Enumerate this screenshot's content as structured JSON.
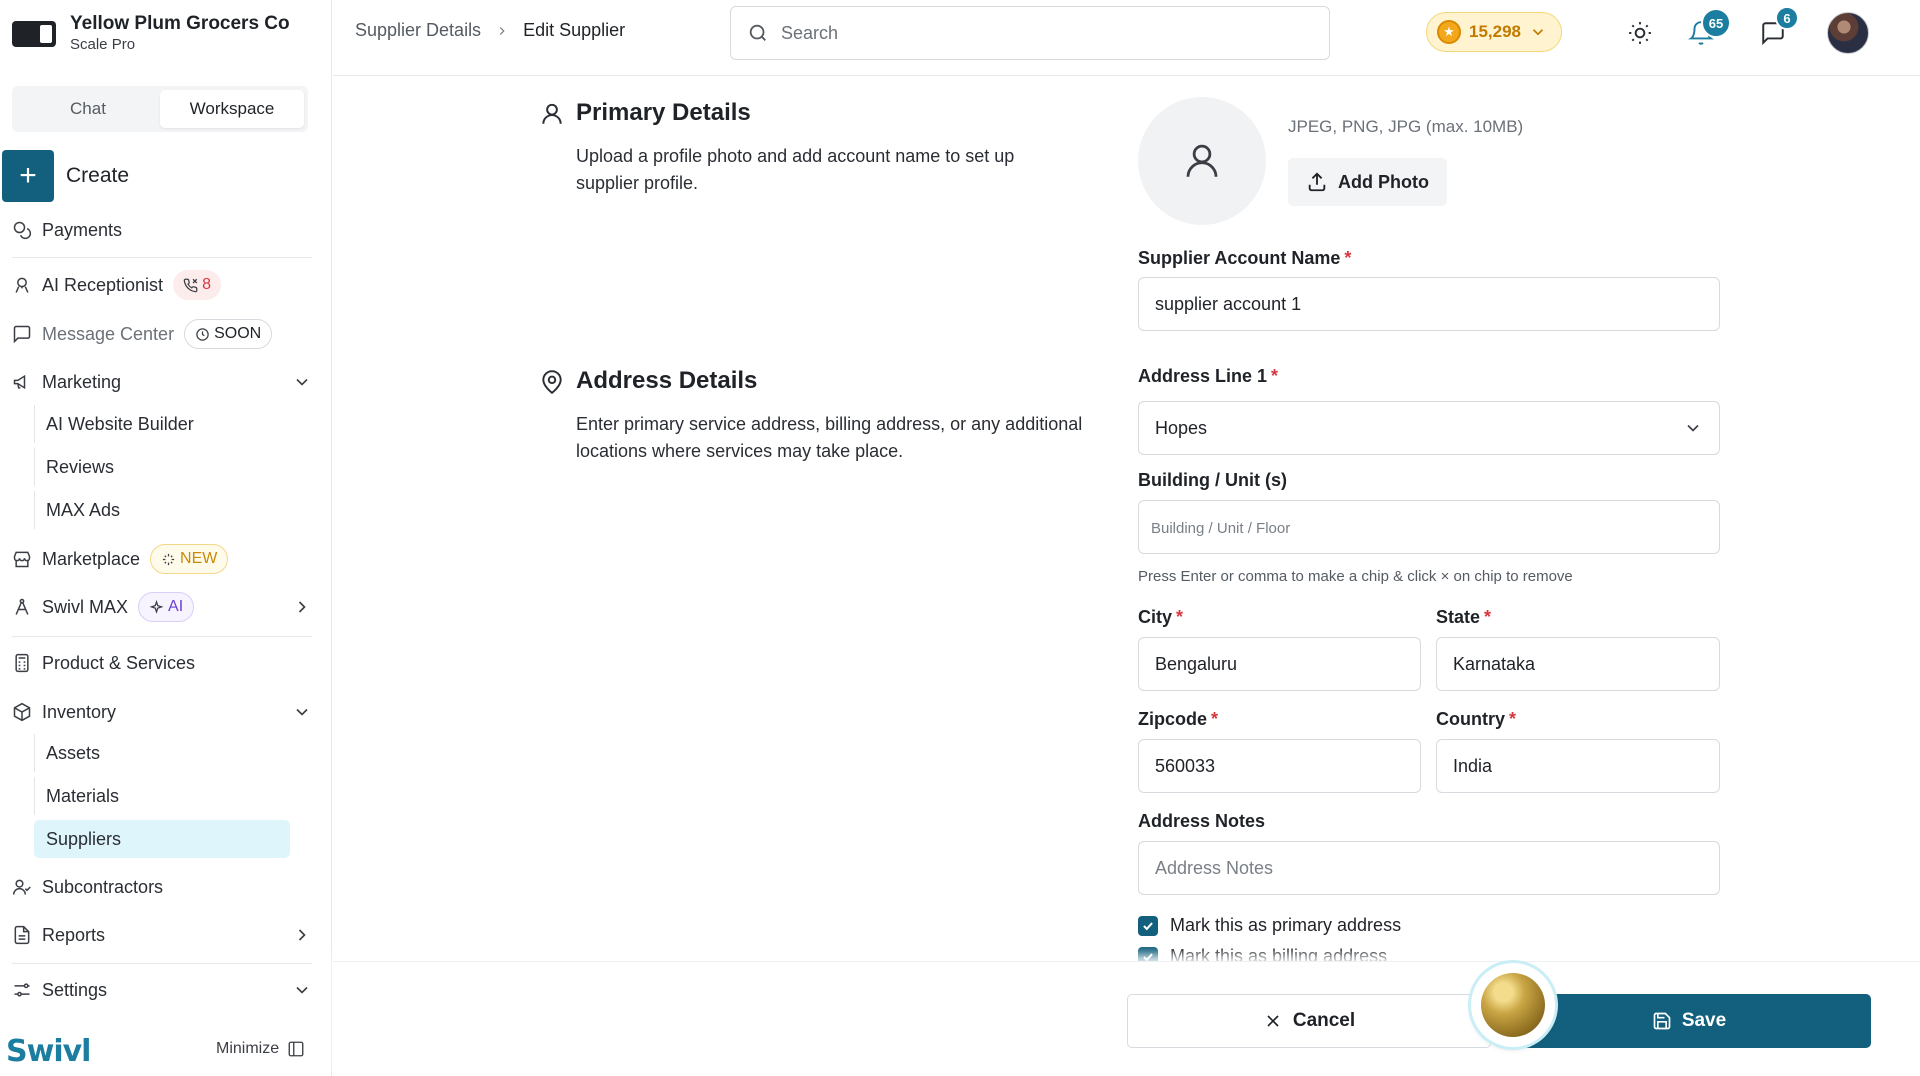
{
  "sidebar": {
    "brand_name": "Yellow Plum Grocers Co",
    "brand_plan": "Scale Pro",
    "tabs": [
      {
        "label": "Chat"
      },
      {
        "label": "Workspace"
      }
    ],
    "create_label": "Create",
    "payments": "Payments",
    "ai_receptionist": "AI Receptionist",
    "ai_receptionist_badge": "8",
    "message_center": "Message Center",
    "message_center_badge": "SOON",
    "marketing": "Marketing",
    "marketing_items": [
      "AI Website Builder",
      "Reviews",
      "MAX Ads"
    ],
    "marketplace": "Marketplace",
    "marketplace_badge": "NEW",
    "swivl_max": "Swivl MAX",
    "swivl_max_badge": "AI",
    "product_services": "Product & Services",
    "inventory": "Inventory",
    "inventory_items": [
      "Assets",
      "Materials",
      "Suppliers"
    ],
    "subcontractors": "Subcontractors",
    "reports": "Reports",
    "settings": "Settings",
    "logo_text": "Swivl",
    "minimize": "Minimize"
  },
  "topbar": {
    "breadcrumb": [
      "Supplier Details",
      "Edit Supplier"
    ],
    "search_placeholder": "Search",
    "coins": "15,298",
    "notifications_count": "65",
    "messages_count": "6"
  },
  "primary": {
    "title": "Primary Details",
    "description": "Upload a profile photo and add account name to set up supplier profile.",
    "photo_hint": "JPEG, PNG, JPG (max. 10MB)",
    "add_photo": "Add Photo",
    "account_name_label": "Supplier Account Name",
    "account_name_value": "supplier account 1"
  },
  "address": {
    "title": "Address Details",
    "description": "Enter primary service address, billing address, or any additional locations where services may take place.",
    "line1_label": "Address Line 1",
    "line1_value": "Hopes",
    "building_label": "Building / Unit (s)",
    "building_placeholder": "Building / Unit / Floor",
    "building_hint": "Press Enter or comma to make a chip & click × on chip to remove",
    "city_label": "City",
    "city_value": "Bengaluru",
    "state_label": "State",
    "state_value": "Karnataka",
    "zip_label": "Zipcode",
    "zip_value": "560033",
    "country_label": "Country",
    "country_value": "India",
    "notes_label": "Address Notes",
    "notes_placeholder": "Address Notes",
    "primary_check": "Mark this as primary address",
    "billing_check": "Mark this as billing address"
  },
  "footer": {
    "cancel": "Cancel",
    "save": "Save"
  },
  "colors": {
    "brand": "#13607e",
    "active_nav": "#dff5fc",
    "required": "#d9363e"
  }
}
